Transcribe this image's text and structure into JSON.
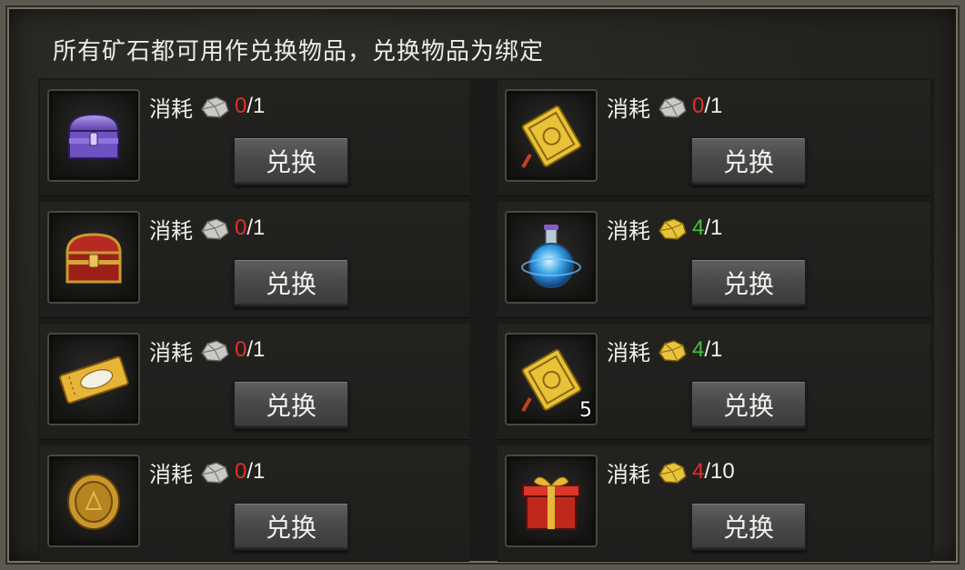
{
  "title": "所有矿石都可用作兑换物品，兑换物品为绑定",
  "colors": {
    "have_insufficient": "#e0302a",
    "have_sufficient": "#47c23a"
  },
  "rows": [
    {
      "item_icon": "purple-chest-icon",
      "ore_icon": "silver-ore-icon",
      "cost_label": "消耗",
      "have": "0",
      "need": "/1",
      "have_status": "insufficient",
      "button_label": "兑换"
    },
    {
      "item_icon": "gold-card-icon",
      "ore_icon": "silver-ore-icon",
      "cost_label": "消耗",
      "have": "0",
      "need": "/1",
      "have_status": "insufficient",
      "button_label": "兑换"
    },
    {
      "item_icon": "red-chest-icon",
      "ore_icon": "silver-ore-icon",
      "cost_label": "消耗",
      "have": "0",
      "need": "/1",
      "have_status": "insufficient",
      "button_label": "兑换"
    },
    {
      "item_icon": "blue-potion-icon",
      "ore_icon": "gold-ore-icon",
      "cost_label": "消耗",
      "have": "4",
      "need": "/1",
      "have_status": "sufficient",
      "button_label": "兑换"
    },
    {
      "item_icon": "gold-ticket-icon",
      "ore_icon": "silver-ore-icon",
      "cost_label": "消耗",
      "have": "0",
      "need": "/1",
      "have_status": "insufficient",
      "button_label": "兑换"
    },
    {
      "item_icon": "gold-card-icon",
      "item_count": "5",
      "ore_icon": "gold-ore-icon",
      "cost_label": "消耗",
      "have": "4",
      "need": "/1",
      "have_status": "sufficient",
      "button_label": "兑换"
    },
    {
      "item_icon": "gold-coin-icon",
      "ore_icon": "silver-ore-icon",
      "cost_label": "消耗",
      "have": "0",
      "need": "/1",
      "have_status": "insufficient",
      "button_label": "兑换"
    },
    {
      "item_icon": "red-gift-box-icon",
      "ore_icon": "gold-ore-icon",
      "cost_label": "消耗",
      "have": "4",
      "need": "/10",
      "have_status": "insufficient",
      "button_label": "兑换"
    }
  ]
}
